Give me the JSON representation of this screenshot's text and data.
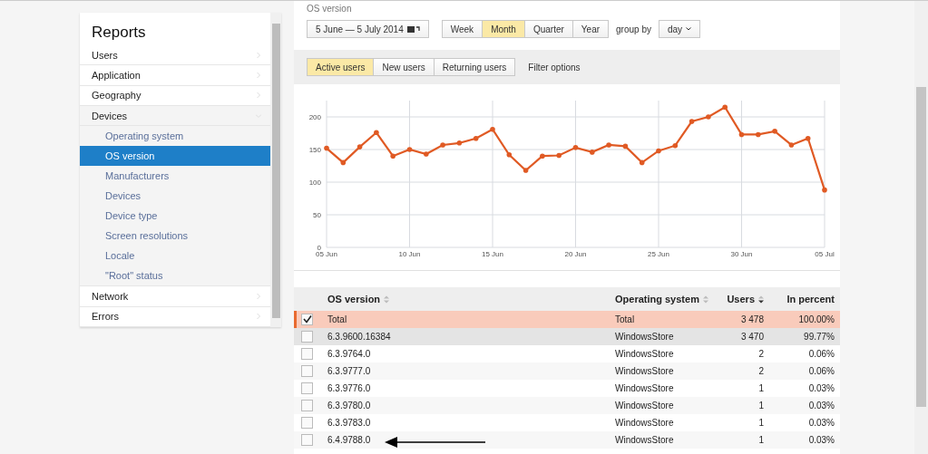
{
  "sidebar": {
    "title": "Reports",
    "items": [
      {
        "label": "Users",
        "expanded": false
      },
      {
        "label": "Application",
        "expanded": false
      },
      {
        "label": "Geography",
        "expanded": false
      },
      {
        "label": "Devices",
        "expanded": true,
        "children": [
          {
            "label": "Operating system",
            "selected": false
          },
          {
            "label": "OS version",
            "selected": true
          },
          {
            "label": "Manufacturers",
            "selected": false
          },
          {
            "label": "Devices",
            "selected": false
          },
          {
            "label": "Device type",
            "selected": false
          },
          {
            "label": "Screen resolutions",
            "selected": false
          },
          {
            "label": "Locale",
            "selected": false
          },
          {
            "label": "\"Root\" status",
            "selected": false
          }
        ]
      },
      {
        "label": "Network",
        "expanded": false
      },
      {
        "label": "Errors",
        "expanded": false
      }
    ]
  },
  "breadcrumb": "OS version",
  "date_range": "5 June — 5 July 2014",
  "periods": [
    {
      "label": "Week",
      "selected": false
    },
    {
      "label": "Month",
      "selected": true
    },
    {
      "label": "Quarter",
      "selected": false
    },
    {
      "label": "Year",
      "selected": false
    }
  ],
  "group_by": {
    "label": "group by",
    "value": "day"
  },
  "metric_tabs": [
    {
      "label": "Active users",
      "selected": true
    },
    {
      "label": "New users",
      "selected": false
    },
    {
      "label": "Returning users",
      "selected": false
    }
  ],
  "filter_link": "Filter options",
  "chart_data": {
    "type": "line",
    "grid": true,
    "categories": [
      "05 Jun",
      null,
      null,
      null,
      null,
      "10 Jun",
      null,
      null,
      null,
      null,
      "15 Jun",
      null,
      null,
      null,
      null,
      "20 Jun",
      null,
      null,
      null,
      null,
      "25 Jun",
      null,
      null,
      null,
      null,
      "30 Jun",
      null,
      null,
      null,
      null,
      "05 Jul"
    ],
    "series": [
      {
        "color": "#e05a24",
        "values": [
          152,
          130,
          154,
          176,
          140,
          150,
          143,
          157,
          160,
          167,
          181,
          142,
          118,
          140,
          141,
          153,
          146,
          157,
          155,
          130,
          148,
          156,
          193,
          200,
          215,
          173,
          173,
          178,
          157,
          167,
          88
        ]
      }
    ],
    "ylim": [
      0,
      225
    ],
    "yticks": [
      0,
      50,
      100,
      150,
      200
    ]
  },
  "table": {
    "columns": [
      {
        "label": "OS version",
        "sortable": true,
        "sorted": false,
        "numeric": false
      },
      {
        "label": "Operating system",
        "sortable": true,
        "sorted": false,
        "numeric": false
      },
      {
        "label": "Users",
        "sortable": true,
        "sorted": true,
        "numeric": true
      },
      {
        "label": "In percent",
        "sortable": false,
        "sorted": false,
        "numeric": true
      }
    ],
    "rows": [
      {
        "checked": true,
        "highlighted": false,
        "cells": [
          "Total",
          "Total",
          "3 478",
          "100.00%"
        ]
      },
      {
        "checked": false,
        "highlighted": true,
        "cells": [
          "6.3.9600.16384",
          "WindowsStore",
          "3 470",
          "99.77%"
        ]
      },
      {
        "checked": false,
        "highlighted": false,
        "cells": [
          "6.3.9764.0",
          "WindowsStore",
          "2",
          "0.06%"
        ]
      },
      {
        "checked": false,
        "highlighted": false,
        "cells": [
          "6.3.9777.0",
          "WindowsStore",
          "2",
          "0.06%"
        ]
      },
      {
        "checked": false,
        "highlighted": false,
        "cells": [
          "6.3.9776.0",
          "WindowsStore",
          "1",
          "0.03%"
        ]
      },
      {
        "checked": false,
        "highlighted": false,
        "cells": [
          "6.3.9780.0",
          "WindowsStore",
          "1",
          "0.03%"
        ]
      },
      {
        "checked": false,
        "highlighted": false,
        "cells": [
          "6.3.9783.0",
          "WindowsStore",
          "1",
          "0.03%"
        ]
      },
      {
        "checked": false,
        "highlighted": false,
        "cells": [
          "6.4.9788.0",
          "WindowsStore",
          "1",
          "0.03%"
        ]
      }
    ]
  }
}
